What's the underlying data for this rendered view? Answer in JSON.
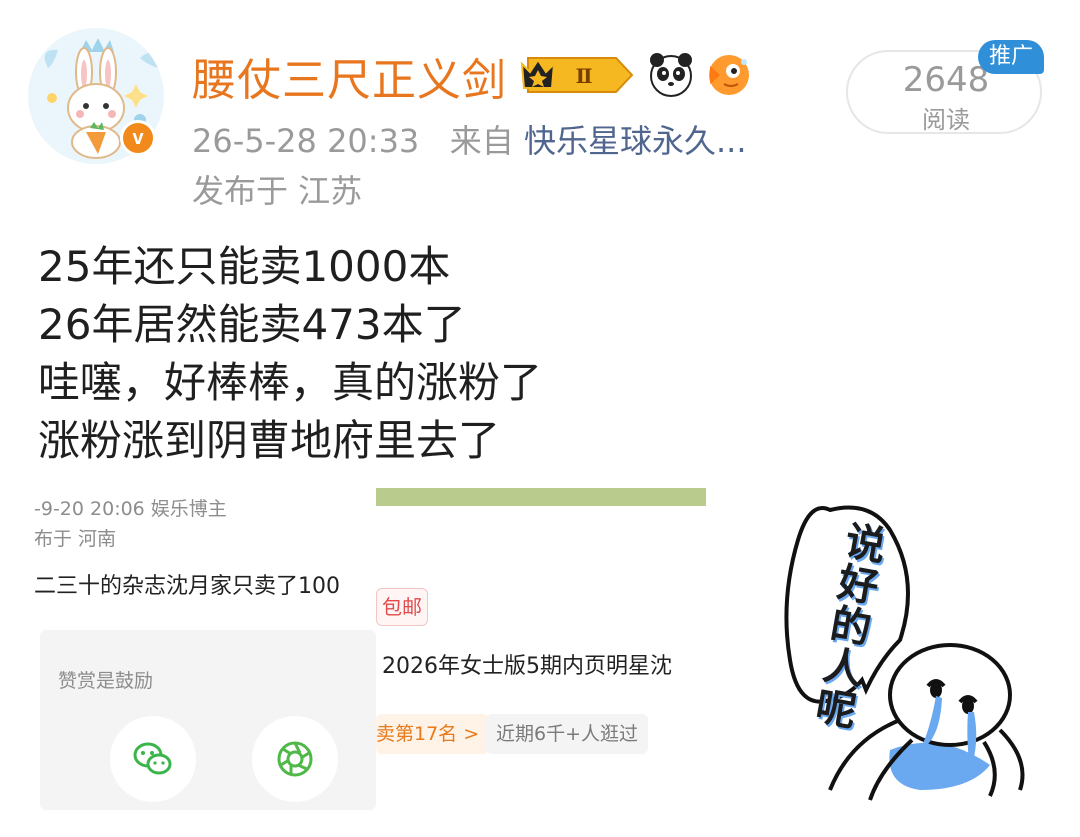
{
  "post": {
    "author": {
      "name": "腰仗三尺正义剑",
      "level_badge": "Ⅱ",
      "avatar_icon": "bunny-avatar-icon",
      "verified_mark": "v"
    },
    "meta": {
      "datetime": "26-5-28 20:33",
      "from_label": "来自",
      "source": "快乐星球永久...",
      "location": "发布于 江苏"
    },
    "stats": {
      "read_count": "2648",
      "read_label": "阅读",
      "promo_label": "推广"
    },
    "lines": [
      "25年还只能卖1000本",
      "26年居然能卖473本了",
      "哇噻，好棒棒，真的涨粉了",
      "涨粉涨到阴曹地府里去了"
    ]
  },
  "embedded_left": {
    "meta": "-9-20 20:06   娱乐博主",
    "location": "布于 河南",
    "text": "二三十的杂志沈月家只卖了100",
    "reward_label": "赞赏是鼓励",
    "pay_icons": [
      "wechat-pay-icon",
      "alipay-icon"
    ]
  },
  "embedded_right": {
    "tag": "包邮",
    "title": "2026年女士版5期内页明星沈",
    "rank": "卖第17名 >",
    "visits": "近期6千+人逛过"
  },
  "sticker": {
    "text": "说好的人呢"
  },
  "colors": {
    "username": "#e8761e",
    "source_link": "#50668f",
    "meta": "#9a9a9a",
    "promo": "#2f8fd9"
  }
}
